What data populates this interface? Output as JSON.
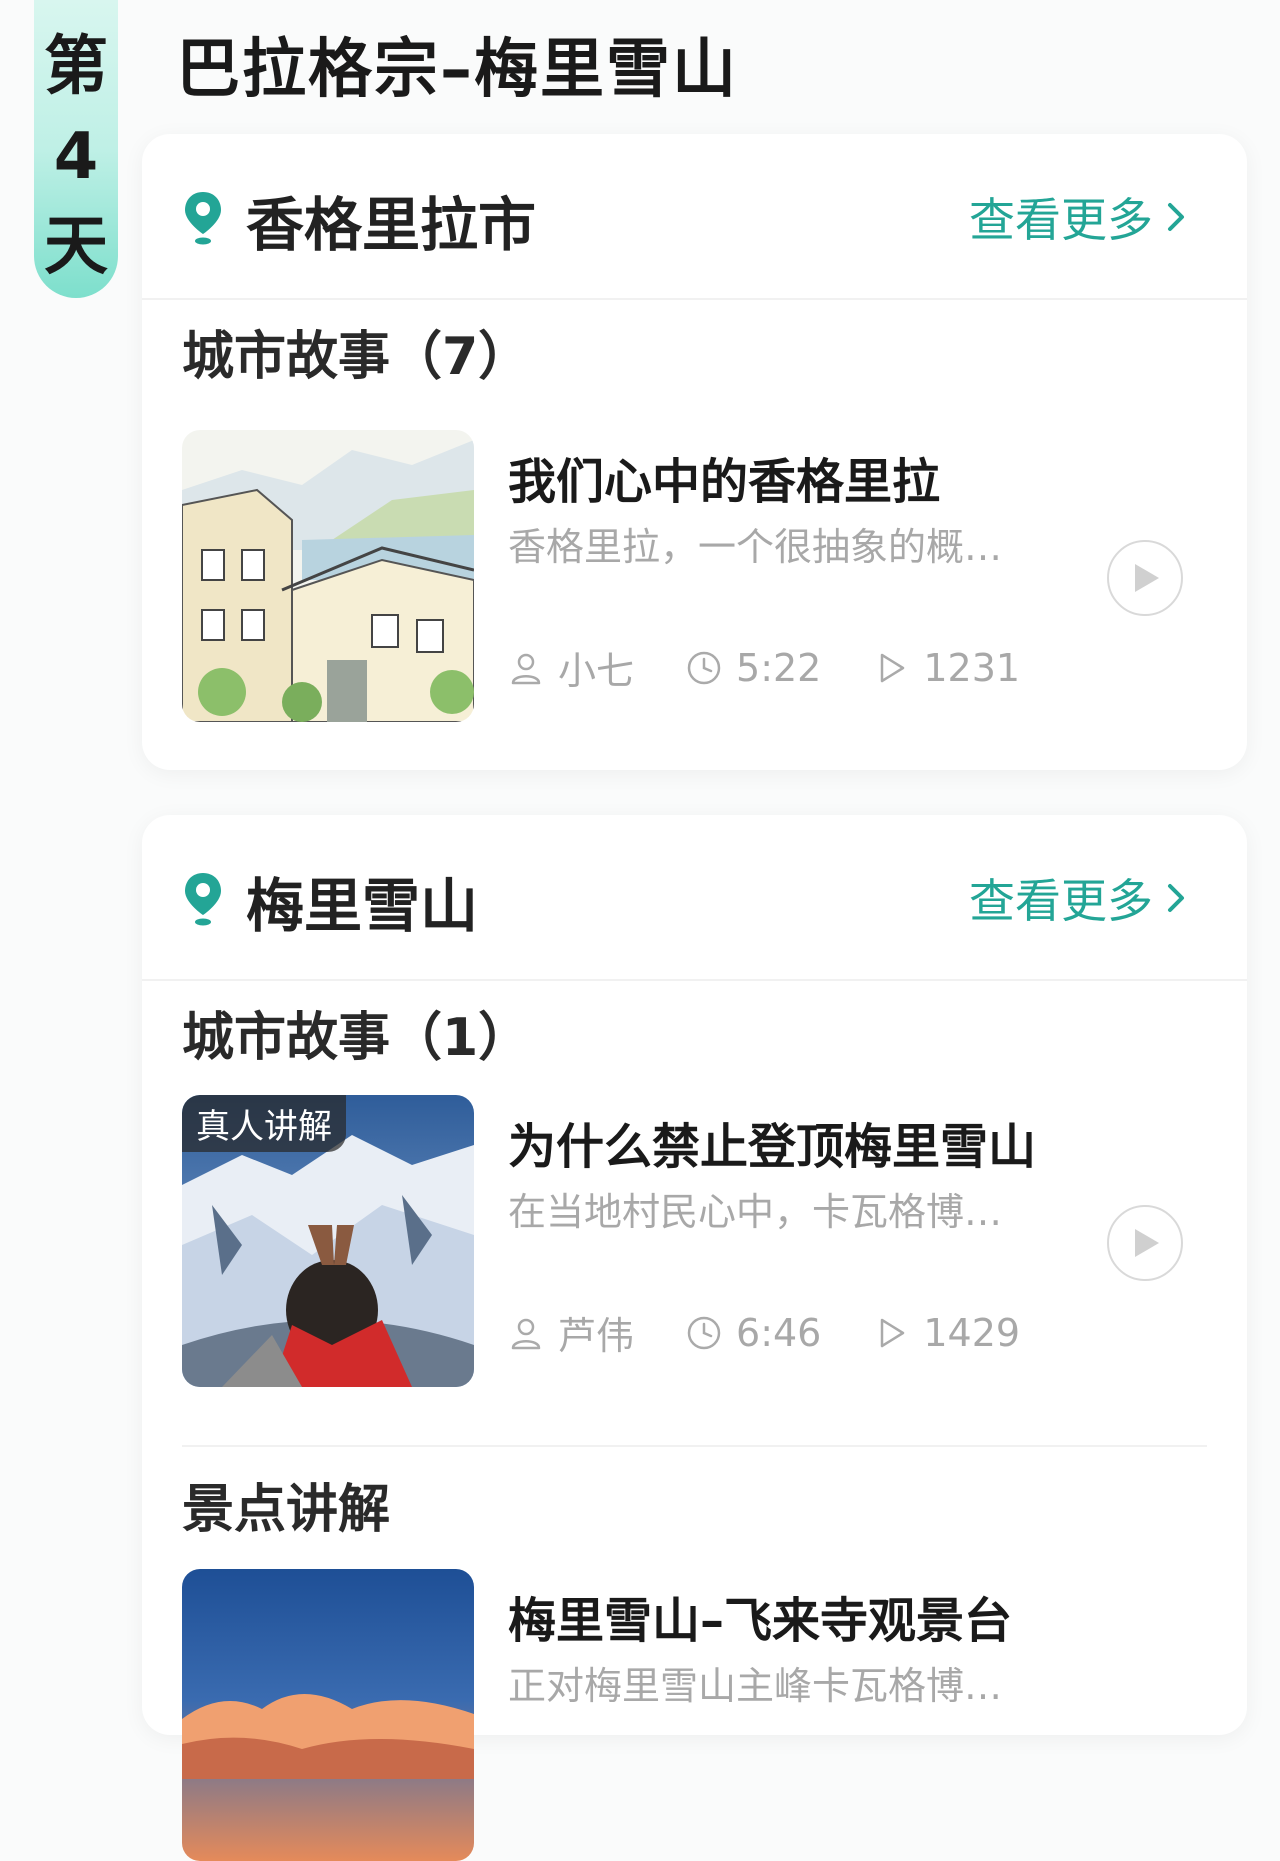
{
  "day": {
    "prefix": "第",
    "number": "4",
    "suffix": "天"
  },
  "title": "巴拉格宗–梅里雪山",
  "colors": {
    "accent": "#23a596",
    "badge": "#7ddfcc"
  },
  "cards": [
    {
      "city": "香格里拉市",
      "more_label": "查看更多",
      "section": "城市故事（7）",
      "story": {
        "title": "我们心中的香格里拉",
        "desc": "香格里拉，一个很抽象的概…",
        "author": "小七",
        "duration": "5:22",
        "plays": "1231",
        "thumb_icon": "sketch-town-illustration"
      }
    },
    {
      "city": "梅里雪山",
      "more_label": "查看更多",
      "section": "城市故事（1）",
      "story": {
        "tag": "真人讲解",
        "title": "为什么禁止登顶梅里雪山",
        "desc": "在当地村民心中，卡瓦格博…",
        "author": "芦伟",
        "duration": "6:46",
        "plays": "1429",
        "thumb_icon": "snow-mountain-prayer-photo"
      },
      "section2": "景点讲解",
      "spot": {
        "title": "梅里雪山–飞来寺观景台",
        "desc": "正对梅里雪山主峰卡瓦格博…",
        "thumb_icon": "sunset-clouds-photo"
      }
    }
  ]
}
